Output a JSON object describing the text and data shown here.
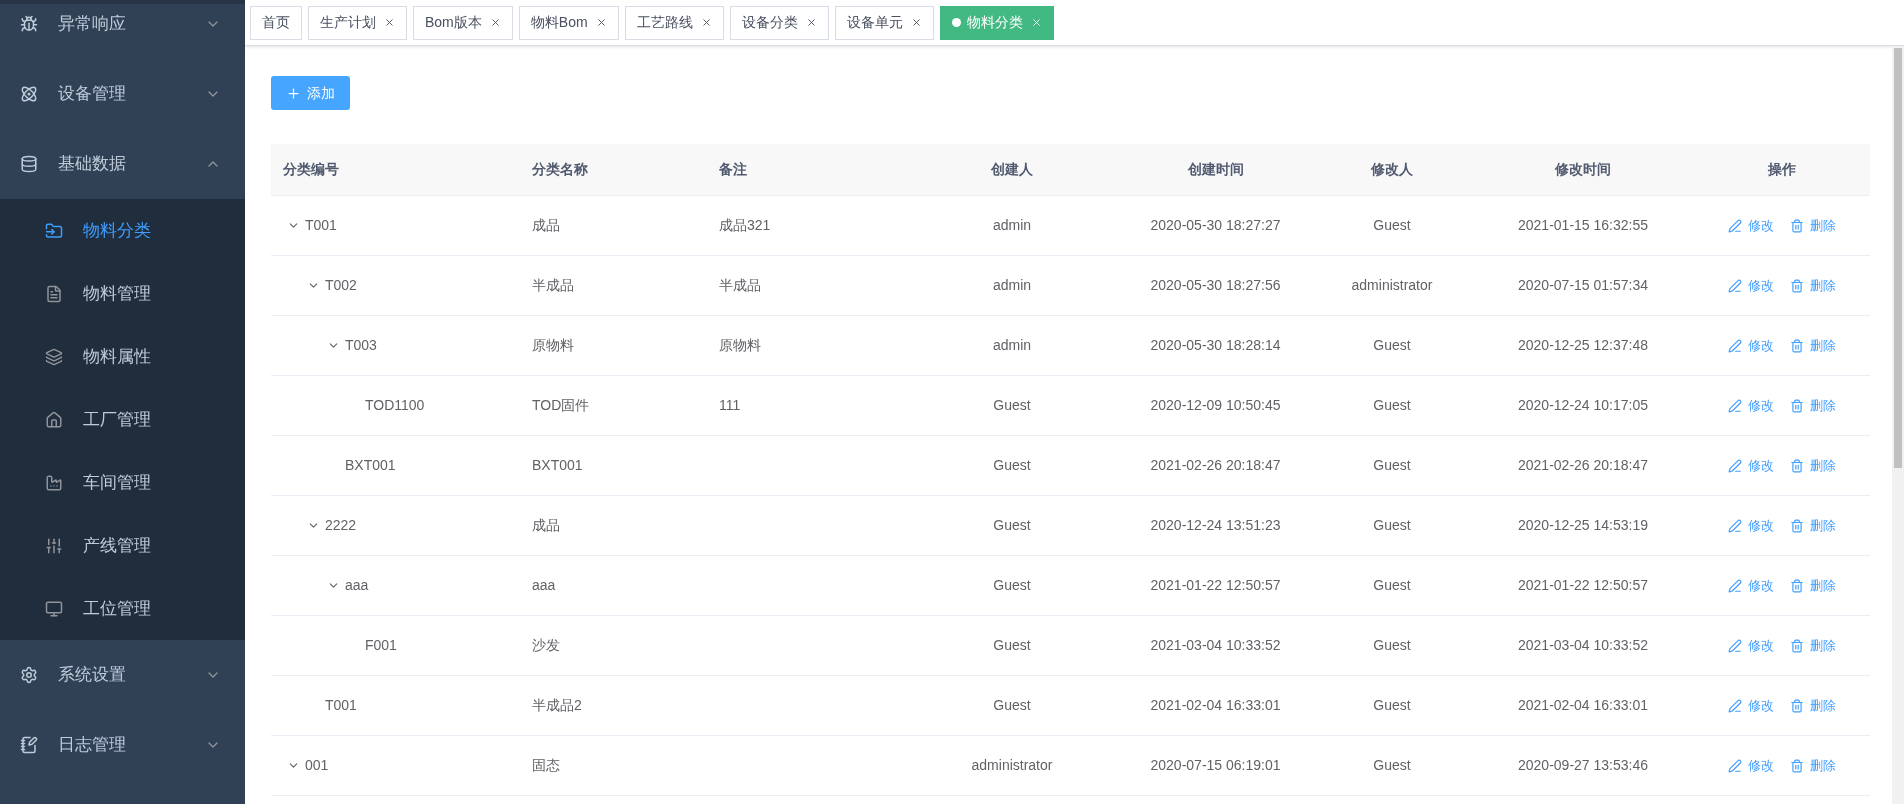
{
  "sidebar": {
    "groups": [
      {
        "label": "异常响应",
        "expanded": false
      },
      {
        "label": "设备管理",
        "expanded": false
      },
      {
        "label": "基础数据",
        "expanded": true,
        "children": [
          {
            "label": "物料分类",
            "selected": true
          },
          {
            "label": "物料管理",
            "selected": false
          },
          {
            "label": "物料属性",
            "selected": false
          },
          {
            "label": "工厂管理",
            "selected": false
          },
          {
            "label": "车间管理",
            "selected": false
          },
          {
            "label": "产线管理",
            "selected": false
          },
          {
            "label": "工位管理",
            "selected": false
          }
        ]
      },
      {
        "label": "系统设置",
        "expanded": false
      },
      {
        "label": "日志管理",
        "expanded": false
      }
    ]
  },
  "tabs": [
    {
      "label": "首页",
      "selected": false,
      "closable": false
    },
    {
      "label": "生产计划",
      "selected": false,
      "closable": true
    },
    {
      "label": "Bom版本",
      "selected": false,
      "closable": true
    },
    {
      "label": "物料Bom",
      "selected": false,
      "closable": true
    },
    {
      "label": "工艺路线",
      "selected": false,
      "closable": true
    },
    {
      "label": "设备分类",
      "selected": false,
      "closable": true
    },
    {
      "label": "设备单元",
      "selected": false,
      "closable": true
    },
    {
      "label": "物料分类",
      "selected": true,
      "closable": true
    }
  ],
  "add_button": "添加",
  "table": {
    "columns": [
      "分类编号",
      "分类名称",
      "备注",
      "创建人",
      "创建时间",
      "修改人",
      "修改时间",
      "操作"
    ],
    "rows": [
      {
        "code": "T001",
        "name": "成品",
        "remark": "成品321",
        "creator": "admin",
        "created": "2020-05-30 18:27:27",
        "modifier": "Guest",
        "modified": "2021-01-15 16:32:55",
        "actions": [
          {
            "kind": "edit",
            "label": "修改"
          },
          {
            "kind": "delete",
            "label": "删除"
          }
        ],
        "expanded": true,
        "children": [
          {
            "code": "T002",
            "name": "半成品",
            "remark": "半成品",
            "creator": "admin",
            "created": "2020-05-30 18:27:56",
            "modifier": "administrator",
            "modified": "2020-07-15 01:57:34",
            "actions": [
              {
                "kind": "edit",
                "label": "修改"
              },
              {
                "kind": "delete",
                "label": "删除"
              }
            ],
            "expanded": true,
            "children": [
              {
                "code": "T003",
                "name": "原物料",
                "remark": "原物料",
                "creator": "admin",
                "created": "2020-05-30 18:28:14",
                "modifier": "Guest",
                "modified": "2020-12-25 12:37:48",
                "actions": [
                  {
                    "kind": "edit",
                    "label": "修改"
                  },
                  {
                    "kind": "delete",
                    "label": "删除"
                  }
                ],
                "expanded": true,
                "children": [
                  {
                    "code": "TOD1100",
                    "name": "TOD固件",
                    "remark": "111",
                    "creator": "Guest",
                    "created": "2020-12-09 10:50:45",
                    "modifier": "Guest",
                    "modified": "2020-12-24 10:17:05",
                    "actions": [
                      {
                        "kind": "edit",
                        "label": "修改"
                      },
                      {
                        "kind": "delete",
                        "label": "删除"
                      }
                    ]
                  }
                ]
              },
              {
                "code": "BXT001",
                "name": "BXT001",
                "creator": "Guest",
                "created": "2021-02-26 20:18:47",
                "modifier": "Guest",
                "modified": "2021-02-26 20:18:47",
                "actions": [
                  {
                    "kind": "edit",
                    "label": "修改"
                  },
                  {
                    "kind": "delete",
                    "label": "删除"
                  }
                ]
              }
            ]
          },
          {
            "code": "2222",
            "name": "成品",
            "creator": "Guest",
            "created": "2020-12-24 13:51:23",
            "modifier": "Guest",
            "modified": "2020-12-25 14:53:19",
            "actions": [
              {
                "kind": "edit",
                "label": "修改"
              },
              {
                "kind": "delete",
                "label": "删除"
              }
            ],
            "expanded": true,
            "children": [
              {
                "code": "aaa",
                "name": "aaa",
                "creator": "Guest",
                "created": "2021-01-22 12:50:57",
                "modifier": "Guest",
                "modified": "2021-01-22 12:50:57",
                "actions": [
                  {
                    "kind": "edit",
                    "label": "修改"
                  },
                  {
                    "kind": "delete",
                    "label": "删除"
                  }
                ],
                "expanded": true,
                "children": [
                  {
                    "code": "F001",
                    "name": "沙发",
                    "creator": "Guest",
                    "created": "2021-03-04 10:33:52",
                    "modifier": "Guest",
                    "modified": "2021-03-04 10:33:52",
                    "actions": [
                      {
                        "kind": "edit",
                        "label": "修改"
                      },
                      {
                        "kind": "delete",
                        "label": "删除"
                      }
                    ]
                  }
                ]
              }
            ]
          },
          {
            "code": "T001",
            "name": "半成品2",
            "creator": "Guest",
            "created": "2021-02-04 16:33:01",
            "modifier": "Guest",
            "modified": "2021-02-04 16:33:01",
            "actions": [
              {
                "kind": "edit",
                "label": "修改"
              },
              {
                "kind": "delete",
                "label": "删除"
              }
            ]
          }
        ]
      },
      {
        "code": "001",
        "name": "固态",
        "creator": "administrator",
        "created": "2020-07-15 06:19:01",
        "modifier": "Guest",
        "modified": "2020-09-27 13:53:46",
        "actions": [
          {
            "kind": "edit",
            "label": "修改"
          },
          {
            "kind": "delete",
            "label": "删除"
          }
        ],
        "expanded": true
      }
    ]
  }
}
